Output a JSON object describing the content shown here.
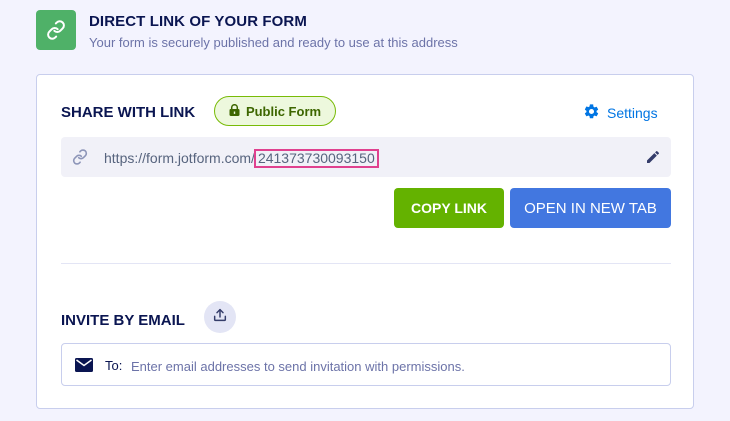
{
  "header": {
    "title": "DIRECT LINK OF YOUR FORM",
    "subtitle": "Your form is securely published and ready to use at this address",
    "icon": "link-icon",
    "icon_bg": "#4fb168"
  },
  "share": {
    "title": "SHARE WITH LINK",
    "badge_label": "Public Form",
    "badge_icon": "lock-icon",
    "settings_label": "Settings",
    "settings_icon": "gear-icon",
    "url_base": "https://form.jotform.com/",
    "form_id": "241373730093150",
    "copy_label": "COPY LINK",
    "open_label": "OPEN IN NEW TAB",
    "copy_color": "#64b200",
    "open_color": "#4277e0"
  },
  "invite": {
    "title": "INVITE BY EMAIL",
    "upload_icon": "upload-icon",
    "to_label": "To:",
    "placeholder": "Enter email addresses to send invitation with permissions."
  }
}
